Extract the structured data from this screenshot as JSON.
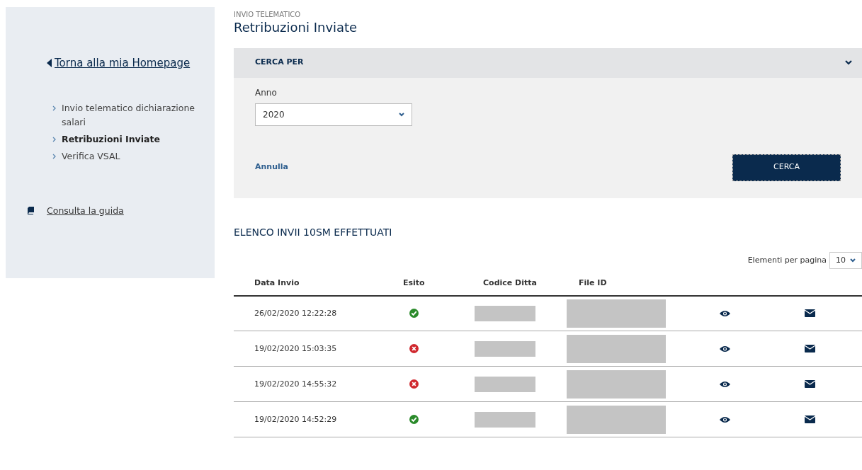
{
  "sidebar": {
    "back_link": "Torna alla mia Homepage",
    "items": [
      {
        "label": "Invio telematico dichiarazione salari",
        "selected": false
      },
      {
        "label": "Retribuzioni Inviate",
        "selected": true
      },
      {
        "label": "Verifica VSAL",
        "selected": false
      }
    ],
    "guide_link": "Consulta la guida"
  },
  "header": {
    "eyebrow": "INVIO TELEMATICO",
    "title": "Retribuzioni Inviate"
  },
  "search_panel": {
    "title": "CERCA PER",
    "expanded": true,
    "year_label": "Anno",
    "year_value": "2020",
    "cancel": "Annulla",
    "submit": "CERCA"
  },
  "list": {
    "title": "ELENCO INVII 10SM EFFETTUATI",
    "page_size_label": "Elementi per pagina",
    "page_size": "10",
    "columns": [
      "Data Invio",
      "Esito",
      "Codice Ditta",
      "File ID"
    ],
    "rows": [
      {
        "date": "26/02/2020 12:22:28",
        "success": true
      },
      {
        "date": "19/02/2020 15:03:35",
        "success": false
      },
      {
        "date": "19/02/2020 14:55:32",
        "success": false
      },
      {
        "date": "19/02/2020 14:52:29",
        "success": true
      }
    ]
  }
}
